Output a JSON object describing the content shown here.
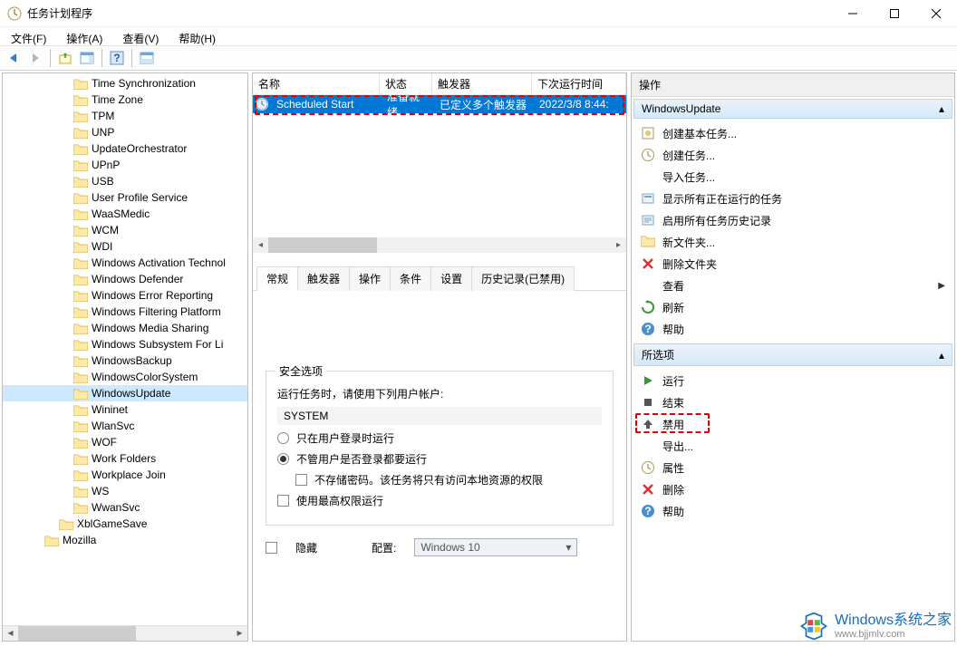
{
  "window": {
    "title": "任务计划程序"
  },
  "menu": {
    "file": "文件(F)",
    "action": "操作(A)",
    "view": "查看(V)",
    "help": "帮助(H)"
  },
  "tree": {
    "items": [
      "Time Synchronization",
      "Time Zone",
      "TPM",
      "UNP",
      "UpdateOrchestrator",
      "UPnP",
      "USB",
      "User Profile Service",
      "WaaSMedic",
      "WCM",
      "WDI",
      "Windows Activation Technol",
      "Windows Defender",
      "Windows Error Reporting",
      "Windows Filtering Platform",
      "Windows Media Sharing",
      "Windows Subsystem For Li",
      "WindowsBackup",
      "WindowsColorSystem",
      "WindowsUpdate",
      "Wininet",
      "WlanSvc",
      "WOF",
      "Work Folders",
      "Workplace Join",
      "WS",
      "WwanSvc"
    ],
    "level1": "XblGameSave",
    "level0": "Mozilla",
    "selected_index": 19
  },
  "task_list": {
    "headers": {
      "name": "名称",
      "status": "状态",
      "trigger": "触发器",
      "next_run": "下次运行时间"
    },
    "row": {
      "name": "Scheduled Start",
      "status": "准备就绪",
      "trigger": "已定义多个触发器",
      "next_run": "2022/3/8 8:44:"
    }
  },
  "tabs": {
    "general": "常规",
    "triggers": "触发器",
    "actions": "操作",
    "conditions": "条件",
    "settings": "设置",
    "history": "历史记录(已禁用)"
  },
  "security": {
    "group_title": "安全选项",
    "run_as_label": "运行任务时，请使用下列用户帐户:",
    "account": "SYSTEM",
    "radio_logged_on": "只在用户登录时运行",
    "radio_any": "不管用户是否登录都要运行",
    "no_store_pw": "不存储密码。该任务将只有访问本地资源的权限",
    "highest_priv": "使用最高权限运行",
    "hidden_label": "隐藏",
    "config_label": "配置:",
    "config_value": "Windows 10"
  },
  "actions_panel": {
    "header": "操作",
    "section1_title": "WindowsUpdate",
    "section1": [
      "创建基本任务...",
      "创建任务...",
      "导入任务...",
      "显示所有正在运行的任务",
      "启用所有任务历史记录",
      "新文件夹...",
      "删除文件夹",
      "查看",
      "刷新",
      "帮助"
    ],
    "section2_title": "所选项",
    "section2": [
      "运行",
      "结束",
      "禁用",
      "导出...",
      "属性",
      "删除",
      "帮助"
    ]
  },
  "watermark": {
    "line1": "Windows系统之家",
    "line2": "www.bjjmlv.com"
  }
}
